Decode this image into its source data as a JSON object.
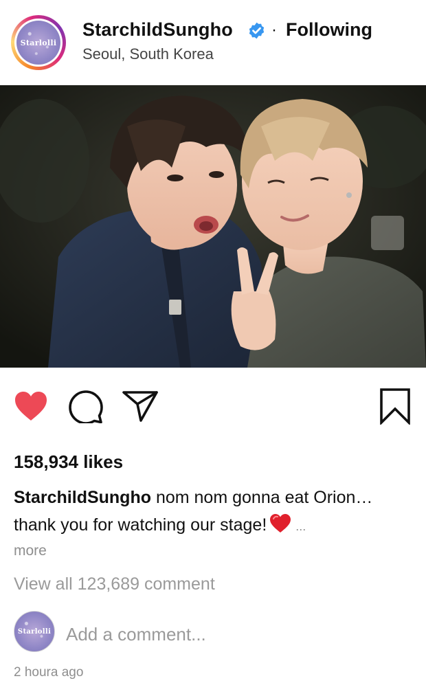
{
  "header": {
    "avatar_text": "Starlolli",
    "username": "StarchildSungho",
    "separator": "·",
    "follow_status": "Following",
    "location": "Seoul, South Korea"
  },
  "post": {
    "photo_icon": "photo-of-two-people",
    "liked": true,
    "like_color": "#ed4956"
  },
  "actions": {
    "like_icon": "heart-filled-icon",
    "comment_icon": "comment-bubble-icon",
    "share_icon": "paper-plane-icon",
    "save_icon": "bookmark-icon"
  },
  "stats": {
    "likes_text": "158,934 likes"
  },
  "caption": {
    "username": "StarchildSungho",
    "text": " nom nom gonna eat Orion… thank you for watching our stage!",
    "emoji_icon": "red-heart-emoji",
    "ellipsis": "...",
    "more_label": "more"
  },
  "comments": {
    "view_all_label": "View all 123,689 comment",
    "input_placeholder": "Add a comment...",
    "avatar_text": "Starlolli"
  },
  "timestamp": "2 houra ago",
  "colors": {
    "verified": "#3897f0",
    "muted": "#8e8e8e"
  }
}
